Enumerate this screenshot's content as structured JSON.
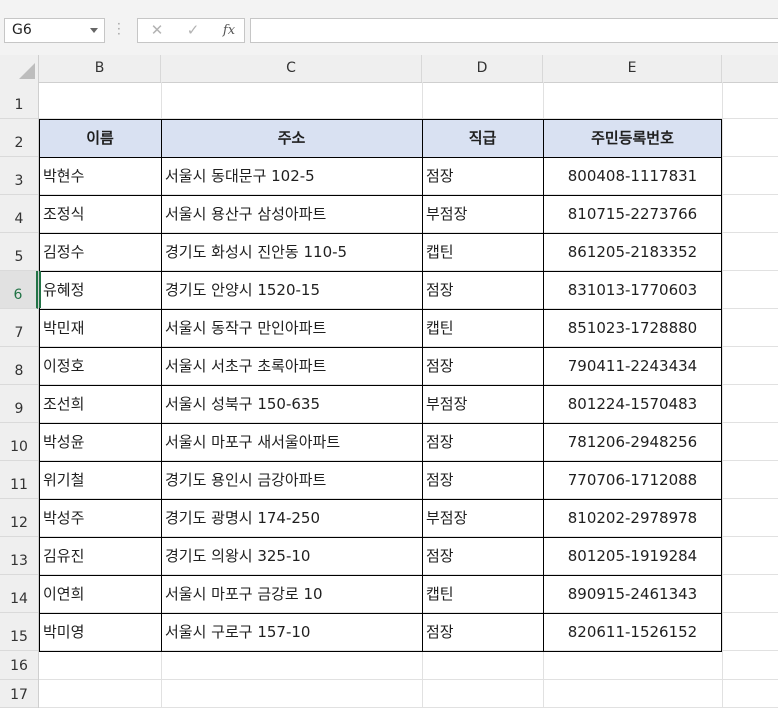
{
  "formula_bar": {
    "name_box": "G6",
    "cancel_icon": "✕",
    "enter_icon": "✓",
    "fx_label": "fx",
    "formula": ""
  },
  "columns": [
    "B",
    "C",
    "D",
    "E"
  ],
  "rows": [
    "1",
    "2",
    "3",
    "4",
    "5",
    "6",
    "7",
    "8",
    "9",
    "10",
    "11",
    "12",
    "13",
    "14",
    "15",
    "16",
    "17"
  ],
  "active_row": "6",
  "table": {
    "headers": [
      "이름",
      "주소",
      "직급",
      "주민등록번호"
    ],
    "rows": [
      [
        "박현수",
        "서울시 동대문구 102-5",
        "점장",
        "800408-1117831"
      ],
      [
        "조정식",
        "서울시 용산구 삼성아파트",
        "부점장",
        "810715-2273766"
      ],
      [
        "김정수",
        "경기도 화성시 진안동 110-5",
        "캡틴",
        "861205-2183352"
      ],
      [
        "유혜정",
        "경기도 안양시 1520-15",
        "점장",
        "831013-1770603"
      ],
      [
        "박민재",
        "서울시 동작구 만인아파트",
        "캡틴",
        "851023-1728880"
      ],
      [
        "이정호",
        "서울시 서초구 초록아파트",
        "점장",
        "790411-2243434"
      ],
      [
        "조선희",
        "서울시 성북구 150-635",
        "부점장",
        "801224-1570483"
      ],
      [
        "박성윤",
        "서울시 마포구 새서울아파트",
        "점장",
        "781206-2948256"
      ],
      [
        "위기철",
        "경기도 용인시 금강아파트",
        "점장",
        "770706-1712088"
      ],
      [
        "박성주",
        "경기도 광명시 174-250",
        "부점장",
        "810202-2978978"
      ],
      [
        "김유진",
        "경기도 의왕시 325-10",
        "점장",
        "801205-1919284"
      ],
      [
        "이연희",
        "서울시 마포구 금강로 10",
        "캡틴",
        "890915-2461343"
      ],
      [
        "박미영",
        "서울시 구로구 157-10",
        "점장",
        "820611-1526152"
      ]
    ]
  },
  "colors": {
    "header_fill": "#d9e1f2",
    "accent": "#217346"
  }
}
